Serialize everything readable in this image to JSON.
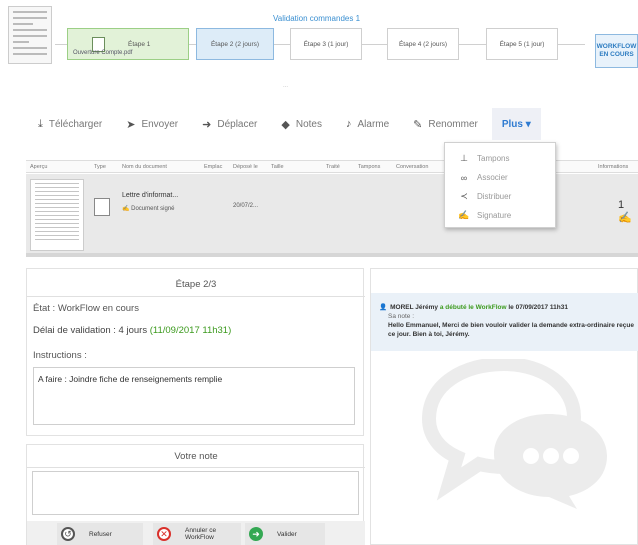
{
  "workflow": {
    "title": "Validation commandes 1",
    "document_label": "Ouverture Compte.pdf",
    "subtitle": "...",
    "steps": [
      {
        "label": "Étape 1",
        "state": "done"
      },
      {
        "label": "Étape 2 (2 jours)",
        "state": "current"
      },
      {
        "label": "Étape 3 (1 jour)",
        "state": "pending"
      },
      {
        "label": "Étape 4 (2 jours)",
        "state": "pending"
      },
      {
        "label": "Étape 5 (1 jour)",
        "state": "pending"
      }
    ],
    "status": "WORKFLOW EN COURS"
  },
  "toolbar": {
    "download": "Télécharger",
    "send": "Envoyer",
    "move": "Déplacer",
    "notes": "Notes",
    "alarm": "Alarme",
    "rename": "Renommer",
    "more": "Plus ▾"
  },
  "dropdown": {
    "items": [
      {
        "label": "Tampons",
        "icon": "stamp-icon"
      },
      {
        "label": "Associer",
        "icon": "link-icon"
      },
      {
        "label": "Distribuer",
        "icon": "share-icon"
      },
      {
        "label": "Signature",
        "icon": "signature-icon"
      }
    ]
  },
  "grid": {
    "columns": [
      "Aperçu",
      "Type",
      "Nom du document",
      "Emplac",
      "Déposé le",
      "Taille",
      "Traité",
      "Tampons",
      "Conversation",
      "Informations"
    ],
    "row": {
      "name": "Lettre d'informat...",
      "signed": "Document signé",
      "date": "20/07/2...",
      "info": "1"
    }
  },
  "step_panel": {
    "title": "Étape 2/3",
    "state": "État : WorkFlow en cours",
    "delay_label": "Délai de validation : 4 jours ",
    "delay_date": "(11/09/2017 11h31)",
    "instructions_label": "Instructions :",
    "instructions_text": "A faire : Joindre fiche de renseignements remplie"
  },
  "note_panel": {
    "title": "Votre note",
    "refuse": "Refuser",
    "cancel_line1": "Annuler ce",
    "cancel_line2": "WorkFlow",
    "validate": "Valider"
  },
  "comment": {
    "author": "MOREL Jérémy",
    "action": "a débuté le WorkFlow",
    "date": "le 07/09/2017 11h31",
    "note_label": "Sa note :",
    "text": "Hello Emmanuel, Merci de bien vouloir valider la demande extra-ordinaire reçue ce jour. Bien à toi, Jérémy."
  }
}
